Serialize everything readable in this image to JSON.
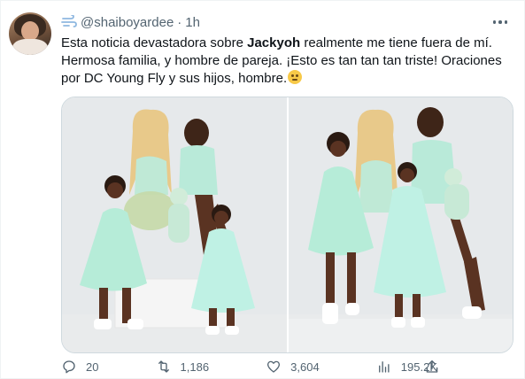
{
  "author": {
    "handle": "@shaiboyardee",
    "separator": "·",
    "time": "1h",
    "badge_icon": "dash-wind-icon"
  },
  "tweet": {
    "part1": "Esta noticia devastadora sobre ",
    "bold": "Jackyoh",
    "part2": " realmente me tiene fuera de mí. Hermosa familia, y hombre de pareja. ¡Esto es tan tan tan triste! Oraciones por DC Young Fly y sus hijos, hombre.",
    "emoji": "sad-face-emoji"
  },
  "media": {
    "count": 2,
    "background": "#e4e7ea",
    "accent_outfit": "#b9ead9"
  },
  "actions": {
    "replies": "20",
    "retweets": "1,186",
    "likes": "3,604",
    "views": "195.2K"
  },
  "colors": {
    "text": "#0f1419",
    "secondary": "#536471",
    "border": "#cfd9de"
  }
}
